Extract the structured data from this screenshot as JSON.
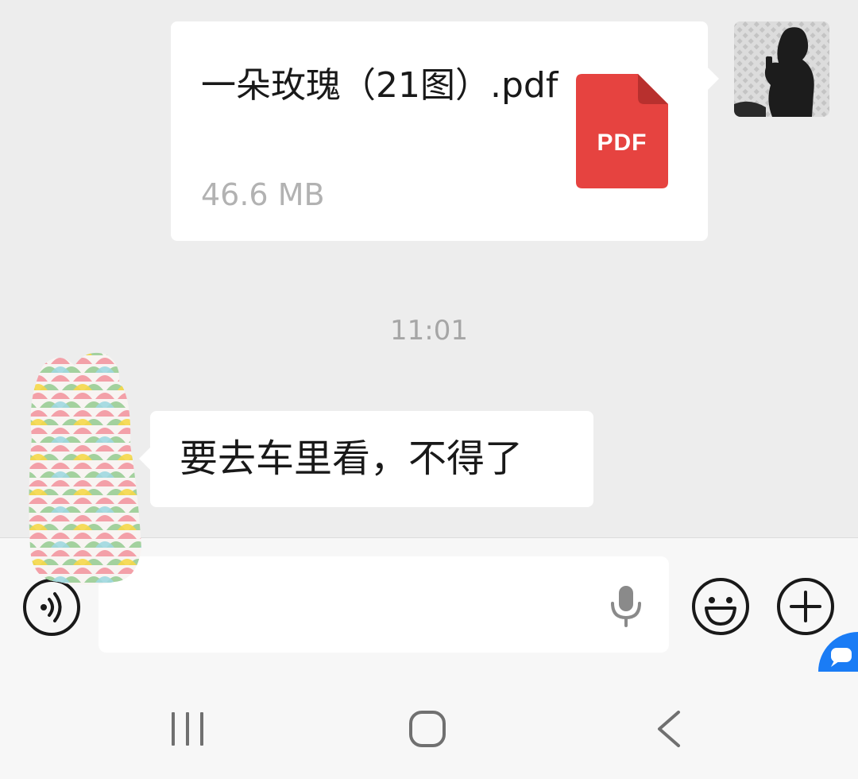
{
  "messages": [
    {
      "direction": "outgoing",
      "type": "file",
      "file_name": "一朵玫瑰（21图）.pdf",
      "file_size": "46.6 MB",
      "file_type_label": "PDF",
      "file_icon": "pdf-file-icon",
      "avatar_icon": "user-avatar"
    },
    {
      "direction": "incoming",
      "type": "text",
      "text": "要去车里看，不得了",
      "avatar_icon": "contact-avatar"
    }
  ],
  "timestamp": "11:01",
  "input_bar": {
    "placeholder": "",
    "voice_icon": "voice-mode-icon",
    "mic_icon": "microphone-icon",
    "emoji_icon": "emoji-icon",
    "plus_icon": "plus-icon"
  },
  "navbar": {
    "recent_icon": "recent-apps-icon",
    "home_icon": "home-icon",
    "back_icon": "back-icon"
  },
  "colors": {
    "background": "#ededed",
    "bubble": "#ffffff",
    "pdf_red": "#e64340",
    "secondary_text": "#b2b2b2",
    "floating_bubble_blue": "#1a7cf5"
  }
}
